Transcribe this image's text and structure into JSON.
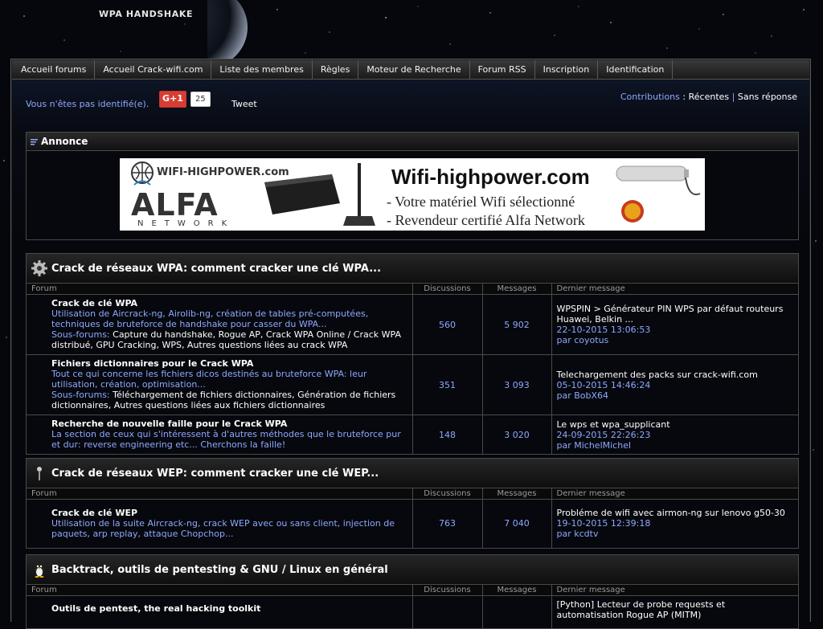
{
  "site": {
    "title": "WPA HANDSHAKE"
  },
  "nav": [
    "Accueil forums",
    "Accueil Crack-wifi.com",
    "Liste des membres",
    "Règles",
    "Moteur de Recherche",
    "Forum RSS",
    "Inscription",
    "Identification"
  ],
  "status": {
    "not_logged": "Vous n'êtes pas identifié(e).",
    "gplus_label": "G+1",
    "gplus_count": "25",
    "tweet": "Tweet",
    "contributions": "Contributions",
    "sep1": ":",
    "recentes": "Récentes",
    "sep2": "|",
    "sans_reponse": "Sans réponse"
  },
  "announce": {
    "title": "Annonce",
    "banner": {
      "wifi_brand": "WIFI-HIGHPOWER.com",
      "alfa": "ALFA",
      "network": "NETWORK",
      "domain": "Wifi-highpower.com",
      "line1": "- Votre matériel Wifi sélectionné",
      "line2": "- Revendeur certifié Alfa Network"
    }
  },
  "columns": {
    "forum": "Forum",
    "topics": "Discussions",
    "posts": "Messages",
    "last": "Dernier message"
  },
  "categories": [
    {
      "title": "Crack de réseaux WPA: comment cracker une clé WPA...",
      "icon": "gear-icon",
      "forums": [
        {
          "name": "Crack de clé WPA",
          "desc": "Utilisation de Aircrack-ng, Airolib-ng, création de tables pré-computées, techniques de bruteforce de handshake pour casser du WPA...",
          "sub_label": "Sous-forums:",
          "sub_value": "Capture du handshake, Rogue AP, Crack WPA Online / Crack WPA distribué, GPU Cracking, WPS, Autres questions liées au crack WPA",
          "topics": "560",
          "posts": "5 902",
          "last_title": "WPSPIN > Générateur PIN WPS par défaut routeurs Huawei, Belkin ...",
          "last_date": "22-10-2015 13:06:53",
          "last_by": "par coyotus"
        },
        {
          "name": "Fichiers dictionnaires pour le Crack WPA",
          "desc": "Tout ce qui concerne les fichiers dicos destinés au bruteforce WPA: leur utilisation, création, optimisation...",
          "sub_label": "Sous-forums:",
          "sub_value": "Téléchargement de fichiers dictionnaires, Génération de fichiers dictionnaires, Autres questions liées aux fichiers dictionnaires",
          "topics": "351",
          "posts": "3 093",
          "last_title": "Telechargement des packs sur crack-wifi.com",
          "last_date": "05-10-2015 14:46:24",
          "last_by": "par BobX64"
        },
        {
          "name": "Recherche de nouvelle faille pour le Crack WPA",
          "desc": "La section de ceux qui s'intéressent à d'autres méthodes que le bruteforce pur et dur: reverse engineering etc... Cherchons la faille!",
          "sub_label": "",
          "sub_value": "",
          "topics": "148",
          "posts": "3 020",
          "last_title": "Le wps et wpa_supplicant",
          "last_date": "24-09-2015 22:26:23",
          "last_by": "par MichelMichel"
        }
      ]
    },
    {
      "title": "Crack de réseaux WEP: comment cracker une clé WEP...",
      "icon": "antenna-icon",
      "forums": [
        {
          "name": "Crack de clé WEP",
          "desc": "Utilisation de la suite Aircrack-ng, crack WEP avec ou sans client, injection de paquets, arp replay, attaque Chopchop...",
          "sub_label": "",
          "sub_value": "",
          "topics": "763",
          "posts": "7 040",
          "last_title": "Probléme de wifi avec airmon-ng sur lenovo g50-30",
          "last_date": "19-10-2015 12:39:18",
          "last_by": "par kcdtv"
        }
      ]
    },
    {
      "title": "Backtrack, outils de pentesting & GNU / Linux en général",
      "icon": "penguin-icon",
      "forums": [
        {
          "name": "Outils de pentest, the real hacking toolkit",
          "desc": "",
          "sub_label": "",
          "sub_value": "",
          "topics": "",
          "posts": "",
          "last_title": "[Python] Lecteur de probe requests et automatisation Rogue AP (MITM)",
          "last_date": "",
          "last_by": ""
        }
      ]
    }
  ]
}
